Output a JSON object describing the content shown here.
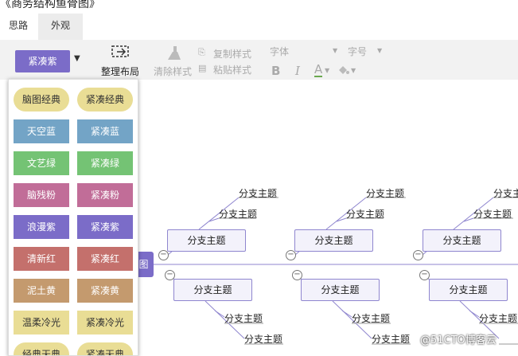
{
  "doc_title": "《商务结构鱼骨图》",
  "tabs": [
    {
      "label": "思路"
    },
    {
      "label": "外观"
    }
  ],
  "toolbar": {
    "theme_label": "紧凑紫",
    "arrange_label": "整理布局",
    "clear_style_label": "清除样式",
    "copy_style_label": "复制样式",
    "paste_style_label": "粘贴样式",
    "font_label": "字体",
    "size_label": "字号",
    "bold": "B",
    "italic": "I",
    "font_color": "A"
  },
  "themes": [
    {
      "label": "脑图经典",
      "bg": "#e9dd95",
      "fg": "#333333",
      "pill": true
    },
    {
      "label": "紧凑经典",
      "bg": "#e9dd95",
      "fg": "#333333",
      "pill": true
    },
    {
      "label": "天空蓝",
      "bg": "#73a4c6",
      "fg": "#ffffff",
      "pill": false
    },
    {
      "label": "紧凑蓝",
      "bg": "#73a4c6",
      "fg": "#ffffff",
      "pill": false
    },
    {
      "label": "文艺绿",
      "bg": "#74c374",
      "fg": "#ffffff",
      "pill": false
    },
    {
      "label": "紧凑绿",
      "bg": "#74c374",
      "fg": "#ffffff",
      "pill": false
    },
    {
      "label": "脑残粉",
      "bg": "#c16d98",
      "fg": "#ffffff",
      "pill": false
    },
    {
      "label": "紧凑粉",
      "bg": "#c16d98",
      "fg": "#ffffff",
      "pill": false
    },
    {
      "label": "浪漫紫",
      "bg": "#7b6cc8",
      "fg": "#ffffff",
      "pill": false
    },
    {
      "label": "紧凑紫",
      "bg": "#7b6cc8",
      "fg": "#ffffff",
      "pill": false
    },
    {
      "label": "清新红",
      "bg": "#c4706c",
      "fg": "#ffffff",
      "pill": false
    },
    {
      "label": "紧凑红",
      "bg": "#c4706c",
      "fg": "#ffffff",
      "pill": false
    },
    {
      "label": "泥土黄",
      "bg": "#c49a6e",
      "fg": "#ffffff",
      "pill": false
    },
    {
      "label": "紧凑黄",
      "bg": "#c49a6e",
      "fg": "#ffffff",
      "pill": false
    },
    {
      "label": "温柔冷光",
      "bg": "#e9dd95",
      "fg": "#333333",
      "pill": false
    },
    {
      "label": "紧凑冷光",
      "bg": "#e9dd95",
      "fg": "#333333",
      "pill": false
    },
    {
      "label": "经典天典",
      "bg": "#e9dd95",
      "fg": "#333333",
      "pill": true
    },
    {
      "label": "紧凑天典",
      "bg": "#e9dd95",
      "fg": "#333333",
      "pill": true
    }
  ],
  "mindmap": {
    "root_fragment": "图",
    "branch_label": "分支主题",
    "collapse_glyph": "−"
  },
  "watermark": "@51CTO博客云"
}
